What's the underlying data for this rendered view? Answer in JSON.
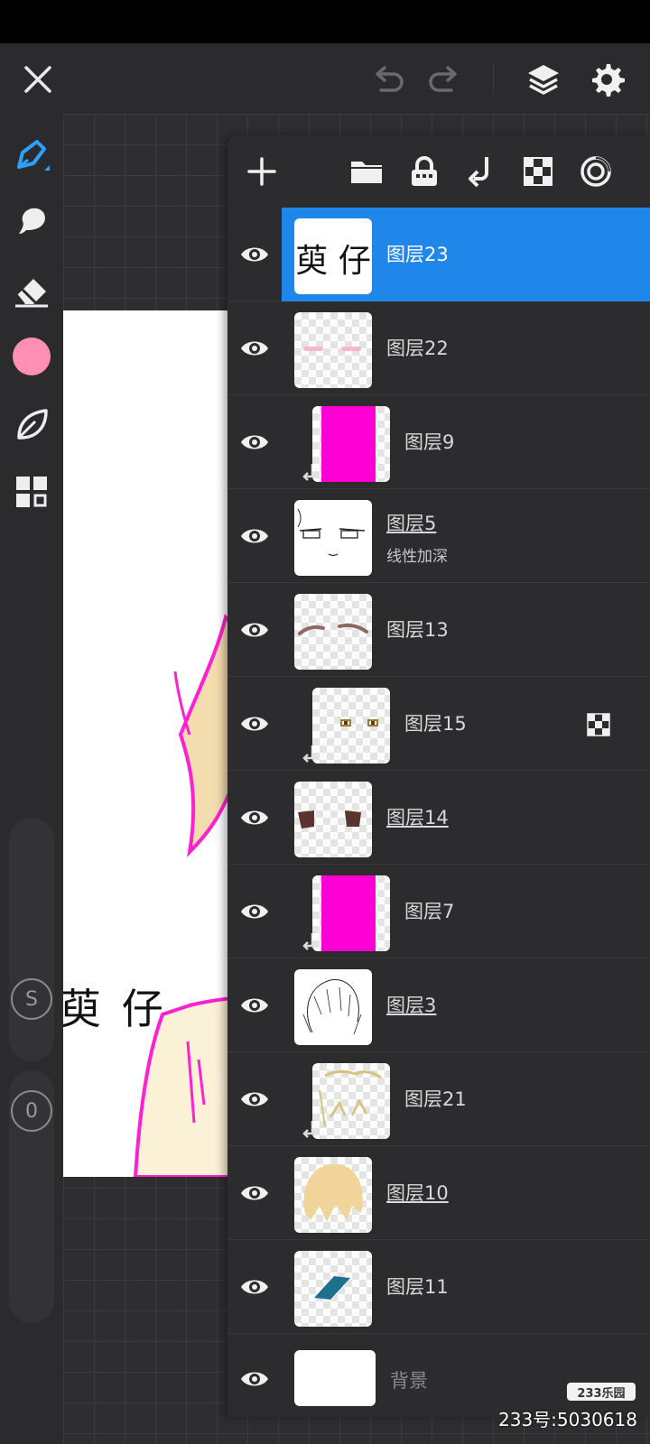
{
  "layers": [
    {
      "name": "图层23",
      "selected": true,
      "underline": false,
      "clipped": false,
      "subtitle": ""
    },
    {
      "name": "图层22",
      "selected": false,
      "underline": false,
      "clipped": false,
      "subtitle": ""
    },
    {
      "name": "图层9",
      "selected": false,
      "underline": false,
      "clipped": true,
      "subtitle": ""
    },
    {
      "name": "图层5",
      "selected": false,
      "underline": true,
      "clipped": false,
      "subtitle": "线性加深"
    },
    {
      "name": "图层13",
      "selected": false,
      "underline": false,
      "clipped": false,
      "subtitle": ""
    },
    {
      "name": "图层15",
      "selected": false,
      "underline": false,
      "clipped": true,
      "subtitle": "",
      "alpha_lock": true
    },
    {
      "name": "图层14",
      "selected": false,
      "underline": true,
      "clipped": false,
      "subtitle": ""
    },
    {
      "name": "图层7",
      "selected": false,
      "underline": false,
      "clipped": true,
      "subtitle": ""
    },
    {
      "name": "图层3",
      "selected": false,
      "underline": true,
      "clipped": false,
      "subtitle": ""
    },
    {
      "name": "图层21",
      "selected": false,
      "underline": false,
      "clipped": true,
      "subtitle": ""
    },
    {
      "name": "图层10",
      "selected": false,
      "underline": true,
      "clipped": false,
      "subtitle": ""
    },
    {
      "name": "图层11",
      "selected": false,
      "underline": false,
      "clipped": false,
      "subtitle": ""
    }
  ],
  "background_layer": {
    "name": "背景"
  },
  "thumb_text": "萸 仔",
  "canvas_text": "萸 仔",
  "left_toolbar": {
    "brush_color": "#ff8fb3",
    "stabilizer_label": "S",
    "opacity_label": "0"
  },
  "colors": {
    "accent": "#1f87ea",
    "panel_bg": "#2c2c2e",
    "magenta": "#ff00d4"
  },
  "watermark": {
    "badge": "233乐园",
    "text": "233号:5030618"
  }
}
